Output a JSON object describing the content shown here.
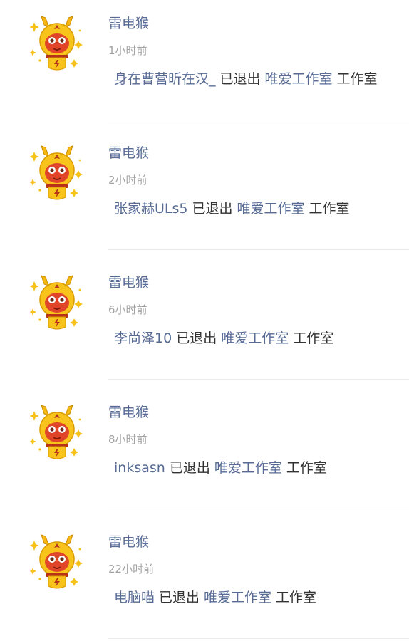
{
  "colors": {
    "link": "#576b95",
    "text": "#333333",
    "time": "#a3a3a3",
    "divider": "#ececec"
  },
  "avatar_icon": "thunder-monkey-avatar-icon",
  "feed": [
    {
      "username": "雷电猴",
      "time": "1小时前",
      "member": "身在曹营昕在汉_",
      "action": "已退出",
      "studio": "唯爱工作室",
      "suffix": "工作室"
    },
    {
      "username": "雷电猴",
      "time": "2小时前",
      "member": "张家赫ULs5",
      "action": "已退出",
      "studio": "唯爱工作室",
      "suffix": "工作室"
    },
    {
      "username": "雷电猴",
      "time": "6小时前",
      "member": "李尚泽10",
      "action": "已退出",
      "studio": "唯爱工作室",
      "suffix": "工作室"
    },
    {
      "username": "雷电猴",
      "time": "8小时前",
      "member": "inksasn",
      "action": "已退出",
      "studio": "唯爱工作室",
      "suffix": "工作室"
    },
    {
      "username": "雷电猴",
      "time": "22小时前",
      "member": "电脑喵",
      "action": "已退出",
      "studio": "唯爱工作室",
      "suffix": "工作室"
    }
  ]
}
